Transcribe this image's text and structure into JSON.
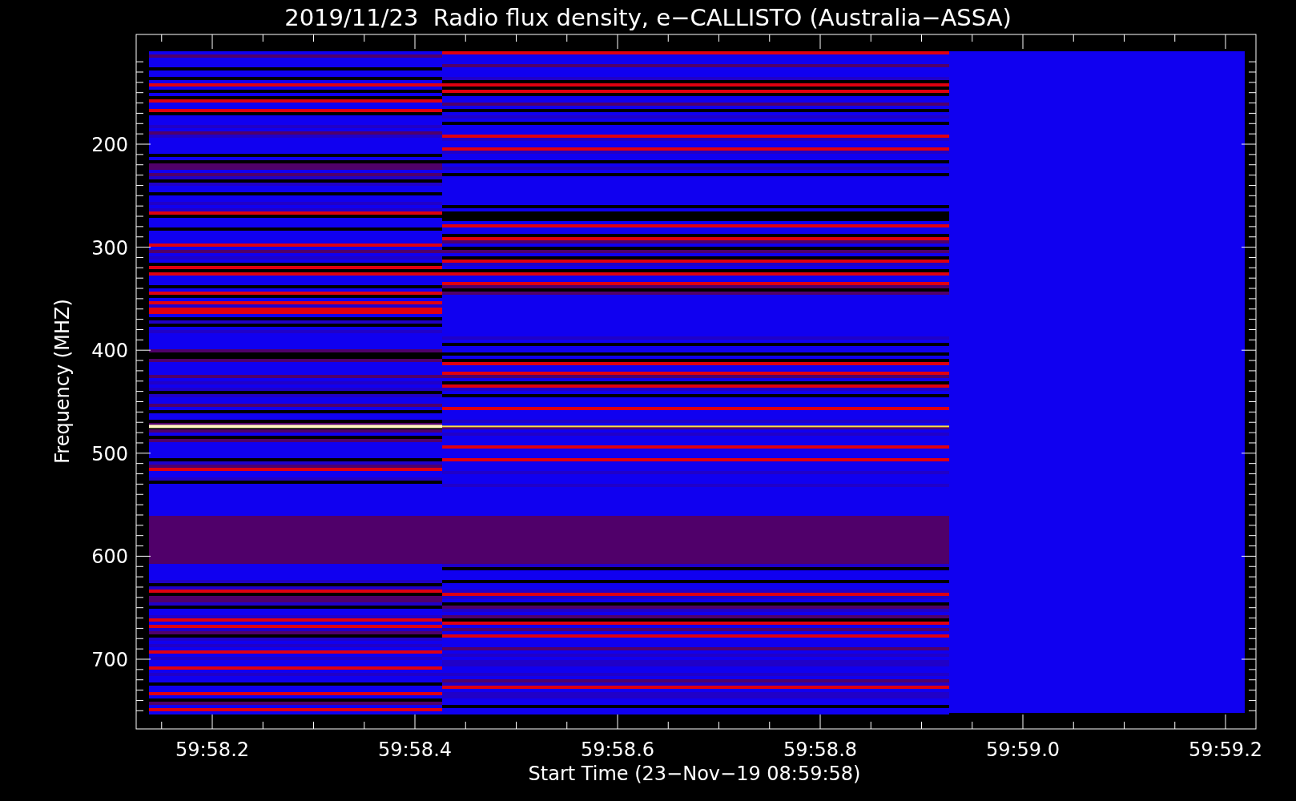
{
  "title": "2019/11/23  Radio flux density, e−CALLISTO (Australia−ASSA)",
  "y_axis": {
    "label": "Frequency (MHZ)",
    "ticks": [
      "200",
      "300",
      "400",
      "500",
      "600",
      "700"
    ]
  },
  "x_axis": {
    "label": "Start Time (23−Nov−19 08:59:58)",
    "ticks": [
      "59:58.2",
      "59:58.4",
      "59:58.6",
      "59:58.8",
      "59:59.0",
      "59:59.2"
    ]
  }
}
